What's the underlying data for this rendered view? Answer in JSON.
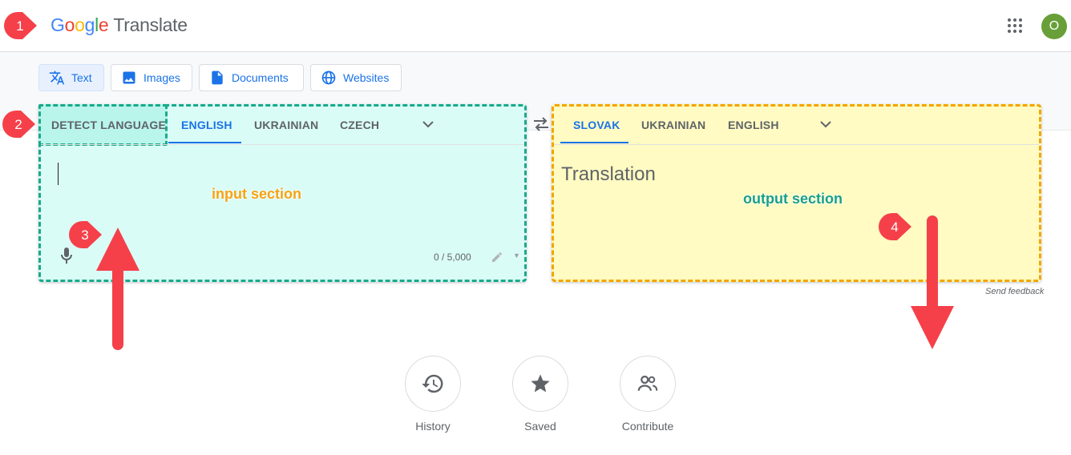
{
  "header": {
    "logo_letters": [
      "G",
      "o",
      "o",
      "g",
      "l",
      "e"
    ],
    "product_name": "Translate",
    "apps_icon": "apps-grid-icon",
    "avatar_initial": "O",
    "avatar_color": "#689f38"
  },
  "modes": [
    {
      "label": "Text",
      "icon": "translate-icon",
      "active": true
    },
    {
      "label": "Images",
      "icon": "image-icon",
      "active": false
    },
    {
      "label": "Documents",
      "icon": "document-icon",
      "active": false
    },
    {
      "label": "Websites",
      "icon": "globe-icon",
      "active": false
    }
  ],
  "source": {
    "tabs": [
      "DETECT LANGUAGE",
      "ENGLISH",
      "UKRAINIAN",
      "CZECH"
    ],
    "selected": "ENGLISH",
    "char_count": "0 / 5,000",
    "label": "input section"
  },
  "target": {
    "tabs": [
      "SLOVAK",
      "UKRAINIAN",
      "ENGLISH"
    ],
    "selected": "SLOVAK",
    "placeholder": "Translation",
    "label": "output section"
  },
  "send_feedback": "Send feedback",
  "bottom": [
    {
      "label": "History",
      "icon": "history-icon"
    },
    {
      "label": "Saved",
      "icon": "star-icon"
    },
    {
      "label": "Contribute",
      "icon": "people-icon"
    }
  ],
  "annotations": {
    "markers": [
      "1",
      "2",
      "3",
      "4"
    ],
    "marker_color": "#f5404a",
    "input_color": "#1aa98b",
    "output_color": "#f2a600"
  }
}
